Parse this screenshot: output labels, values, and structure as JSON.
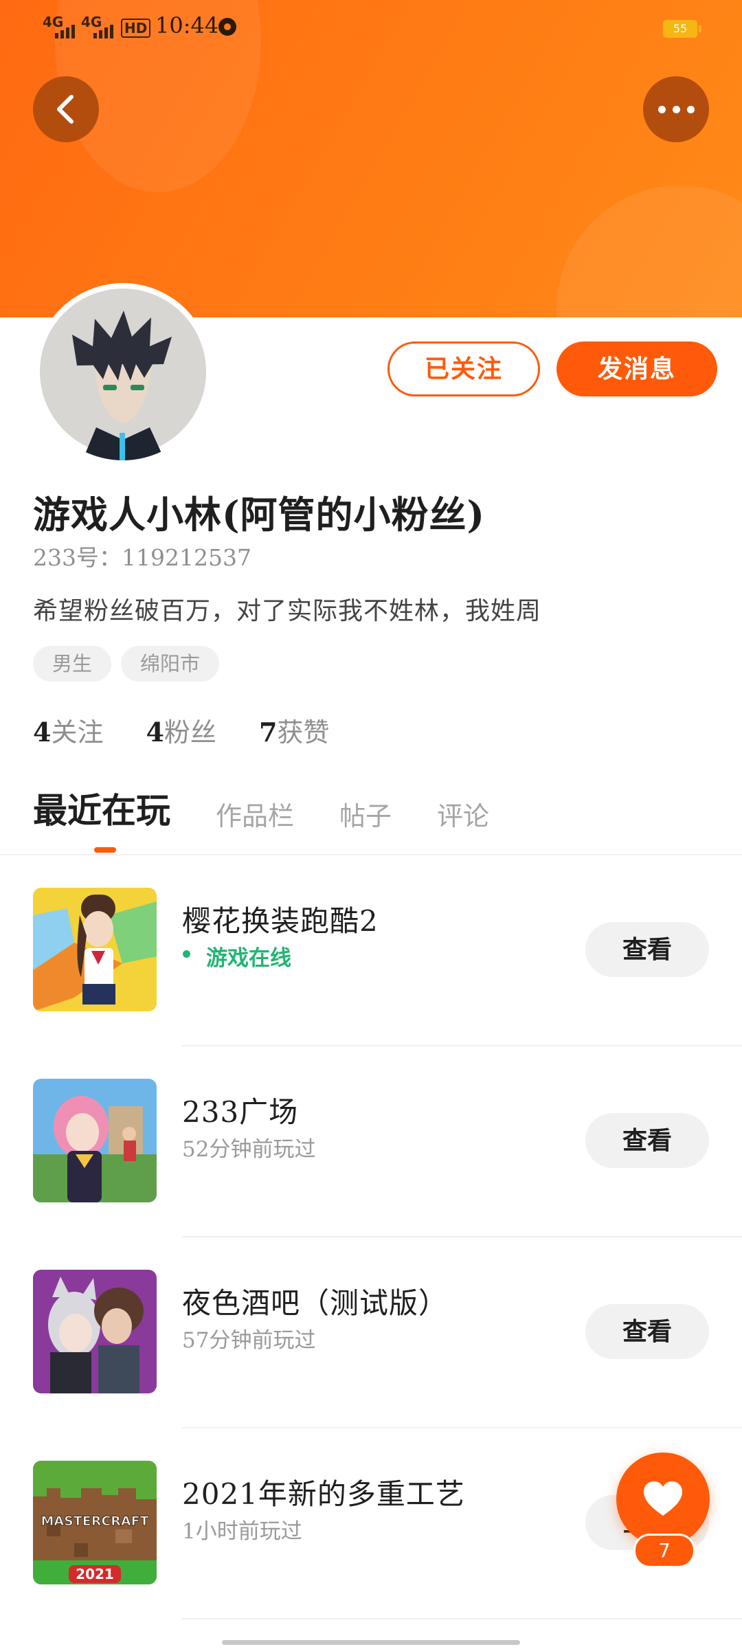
{
  "status_bar": {
    "signal1": "4G",
    "signal2": "4G",
    "hd": "HD",
    "time": "10:44",
    "battery": "55"
  },
  "header": {
    "back_icon": "chevron-left-icon",
    "more_icon": "more-dots-icon",
    "accent_color": "#ff6a12"
  },
  "profile": {
    "followed_label": "已关注",
    "message_label": "发消息",
    "name": "游戏人小林(阿管的小粉丝)",
    "uid": "233号：119212537",
    "bio": "希望粉丝破百万，对了实际我不姓林，我姓周",
    "tags": [
      "男生",
      "绵阳市"
    ],
    "stats": [
      {
        "num": "4",
        "label": "关注"
      },
      {
        "num": "4",
        "label": "粉丝"
      },
      {
        "num": "7",
        "label": "获赞"
      }
    ]
  },
  "tabs": [
    "最近在玩",
    "作品栏",
    "帖子",
    "评论"
  ],
  "games": [
    {
      "title": "樱花换装跑酷2",
      "sub": "游戏在线",
      "online": true,
      "button": "查看"
    },
    {
      "title": "233广场",
      "sub": "52分钟前玩过",
      "online": false,
      "button": "查看"
    },
    {
      "title": "夜色酒吧（测试版）",
      "sub": "57分钟前玩过",
      "online": false,
      "button": "查看"
    },
    {
      "title": "2021年新的多重工艺",
      "sub": "1小时前玩过",
      "online": false,
      "button": "查看"
    }
  ],
  "thumb_texts": {
    "mastercraft": "MASTERCRAFT",
    "year": "2021"
  },
  "fab": {
    "icon": "heart-icon",
    "count": "7"
  }
}
